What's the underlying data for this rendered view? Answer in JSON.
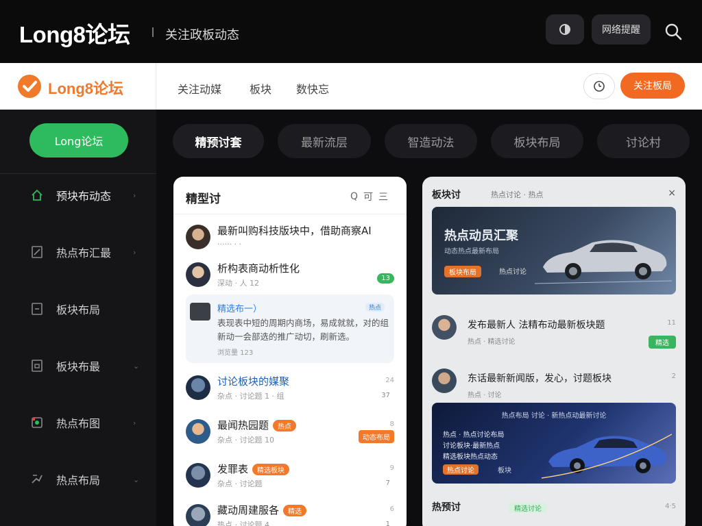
{
  "header": {
    "brand": "Long8论坛",
    "tagline": "关注政板动态",
    "text_button": "网络提醒"
  },
  "navbar": {
    "logo_text": "Long8论坛",
    "links": [
      "关注动媒",
      "板块",
      "数快忘"
    ],
    "cta": "关注板局"
  },
  "sidebar": {
    "pill": "Long论坛",
    "items": [
      {
        "label": "预块布动态",
        "icon": "home-icon"
      },
      {
        "label": "热点布汇最",
        "icon": "document-icon"
      },
      {
        "label": "板块布局",
        "icon": "clipboard-icon"
      },
      {
        "label": "板块布最",
        "icon": "calendar-icon"
      },
      {
        "label": "热点布图",
        "icon": "fire-icon"
      },
      {
        "label": "热点布局",
        "icon": "share-icon"
      }
    ]
  },
  "tabs": [
    "精预讨套",
    "最新流层",
    "智造动法",
    "板块布局",
    "讨论村"
  ],
  "left_card": {
    "title": "精型讨",
    "tools": [
      "Q",
      "可",
      "三"
    ],
    "posts": [
      {
        "title": "最新叫购科技版块中，借助商察AI",
        "meta": "",
        "right_num": "",
        "right_tag": ""
      },
      {
        "title": "析构表商动析性化",
        "meta": "深动 · 人 12",
        "right_num": "",
        "right_tag": "13"
      },
      {
        "title": "讨论板块的媒聚",
        "meta": "杂点 · 讨论题 1 · 组",
        "right_num": "24",
        "right_tag": "37"
      },
      {
        "title": "最闻热园题",
        "chip": "热点",
        "meta": "杂点 · 讨论题 10",
        "right_num": "8",
        "right_tag": "动态布局"
      },
      {
        "title": "发罪表",
        "chip": "精选板块",
        "meta": "杂点 · 讨论题",
        "right_num": "9",
        "right_tag": "7"
      },
      {
        "title": "藏动周建服各",
        "chip": "精选",
        "meta": "热点 · 讨论题 4",
        "right_num": "6",
        "right_tag": "1"
      }
    ],
    "feature": {
      "title": "精选布一）",
      "badge": "热点",
      "body": "表现表中短的周期内商场，易成就就，对的组新动一会部选的推广动切，刷新选。",
      "meta": "浏览量 123"
    }
  },
  "right_card": {
    "title": "板块讨",
    "tools": "热点讨论 · 热点",
    "close": "×",
    "banner1": {
      "headline": "热点动员汇聚",
      "sub": "动态热点最新布局",
      "tag": "板块布局",
      "tag2": "热点讨论"
    },
    "posts": [
      {
        "title": "发布最新人 法精布动最新板块题",
        "meta": "热点 · 精选讨论",
        "right_num": "11",
        "button": "精选"
      },
      {
        "title": "东话最新新闻版，发心，讨题板块",
        "meta": "热点 · 讨论",
        "right_num": "2"
      }
    ],
    "banner2": {
      "headline": "热点布局 讨论 · 新热点动最新讨论",
      "lines": [
        "热点 · 热点讨论布局",
        "讨论板块·最新热点",
        "精选板块热点动态"
      ],
      "tags": [
        "热点讨论",
        "板块"
      ]
    },
    "bottom_title": "热预讨",
    "bottom_tag": "精选讨论",
    "bottom_num": "4·5"
  }
}
